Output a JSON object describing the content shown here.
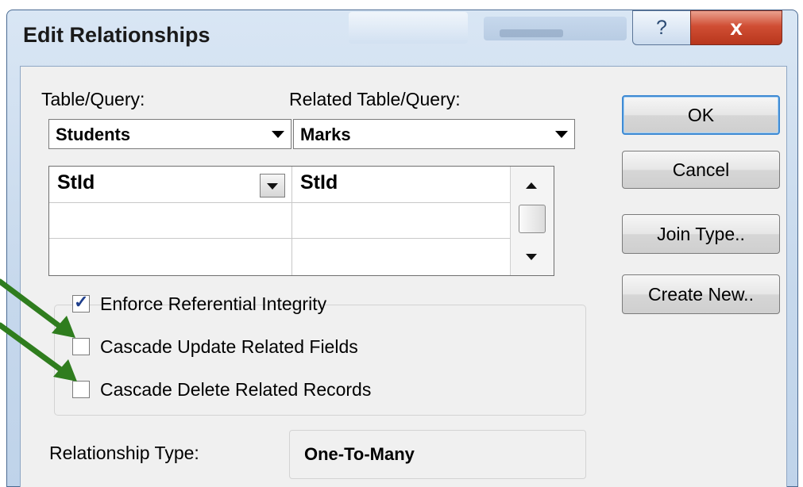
{
  "window": {
    "title": "Edit Relationships",
    "help_glyph": "?",
    "close_glyph": "x"
  },
  "labels": {
    "table_query": "Table/Query:",
    "related_table_query": "Related Table/Query:",
    "relationship_type": "Relationship Type:"
  },
  "combos": {
    "table": "Students",
    "related_table": "Marks"
  },
  "fields_grid": {
    "rows": [
      {
        "left": "StId",
        "right": "StId"
      },
      {
        "left": "",
        "right": ""
      },
      {
        "left": "",
        "right": ""
      }
    ]
  },
  "options": {
    "enforce": {
      "label": "Enforce Referential Integrity",
      "checked": true
    },
    "cascade_update": {
      "label": "Cascade Update Related Fields",
      "checked": false
    },
    "cascade_delete": {
      "label": "Cascade Delete Related Records",
      "checked": false
    }
  },
  "relationship_type_value": "One-To-Many",
  "buttons": {
    "ok": "OK",
    "cancel": "Cancel",
    "join_type": "Join Type..",
    "create_new": "Create New.."
  },
  "colors": {
    "annotation_arrow": "#2f7d1e",
    "close_button": "#c9432a",
    "default_button_border": "#3f8ad3"
  }
}
